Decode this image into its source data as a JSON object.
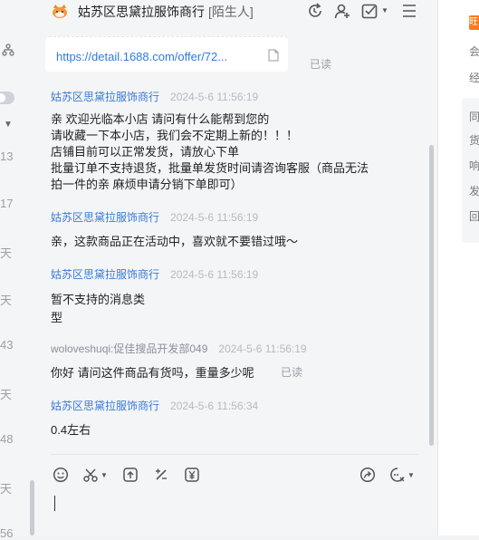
{
  "left_list": {
    "dates": [
      "13",
      "17",
      "天",
      "天",
      "43",
      "天",
      "48",
      "天",
      "56"
    ]
  },
  "header": {
    "shop_name": "姑苏区思黛拉服饰商行",
    "relation_tag": "[陌生人]",
    "buttons": [
      "refresh-icon",
      "add-contact-icon",
      "checkbox-menu-icon",
      "menu-icon"
    ]
  },
  "link_card": {
    "url": "https://detail.1688.com/offer/72...",
    "status": "已读"
  },
  "messages": [
    {
      "sender": "姑苏区思黛拉服饰商行",
      "time": "2024-5-6 11:56:19",
      "lines": [
        "亲 欢迎光临本小店 请问有什么能帮到您的",
        "请收藏一下本小店，我们会不定期上新的！！！",
        "店铺目前可以正常发货，请放心下单",
        "批量订单不支持退货，批量单发货时间请咨询客服（商品无法",
        "拍一件的亲 麻烦申请分销下单即可）"
      ]
    },
    {
      "sender": "姑苏区思黛拉服饰商行",
      "time": "2024-5-6 11:56:19",
      "lines": [
        "亲，这款商品正在活动中，喜欢就不要错过哦～"
      ]
    },
    {
      "sender": "姑苏区思黛拉服饰商行",
      "time": "2024-5-6 11:56:19",
      "lines": [
        "暂不支持的消息类",
        "型"
      ]
    },
    {
      "sender": "woloveshuqi:促佳搜品开发部049",
      "time": "2024-5-6 11:56:19",
      "lines": [
        "你好 请问这件商品有货吗，重量多少呢"
      ],
      "status": "已读"
    },
    {
      "sender": "姑苏区思黛拉服饰商行",
      "time": "2024-5-6 11:56:34",
      "lines": [
        "0.4左右"
      ]
    }
  ],
  "toolbar": {
    "tools": [
      "emoji-icon",
      "scissors-icon",
      "upload-icon",
      "discount-icon",
      "yen-icon",
      "share-icon",
      "quick-reply-icon"
    ]
  },
  "right_panel": {
    "badge": "旺",
    "items": [
      "会",
      "经",
      "同",
      "货",
      "响",
      "发",
      "回"
    ]
  },
  "colors": {
    "link": "#2d7be5",
    "sender": "#3a7bd5",
    "timestamp": "#b6bac1",
    "accent": "#ff7a1a"
  }
}
